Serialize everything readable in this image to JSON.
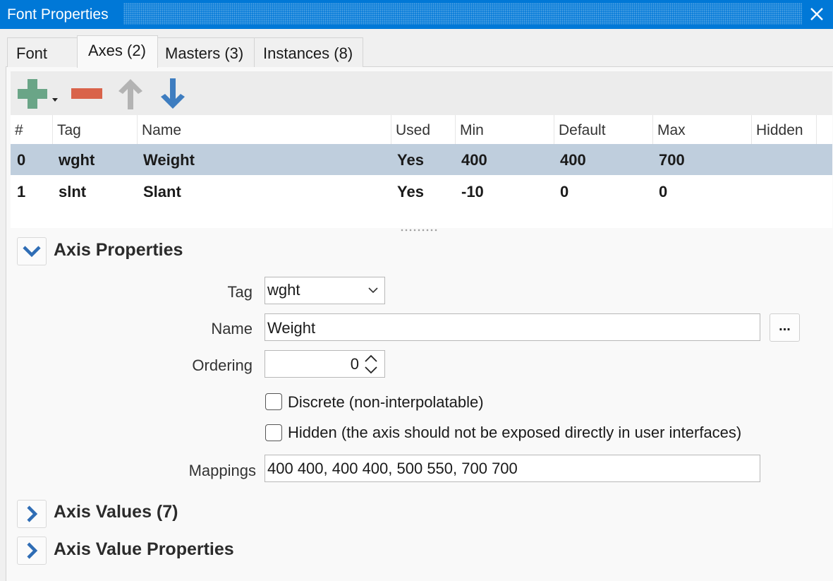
{
  "window": {
    "title": "Font Properties"
  },
  "tabs": [
    {
      "label": "Font"
    },
    {
      "label": "Axes (2)"
    },
    {
      "label": "Masters (3)"
    },
    {
      "label": "Instances (8)"
    }
  ],
  "toolbar": {
    "add_icon": "plus-icon",
    "remove_icon": "minus-icon",
    "up_icon": "arrow-up-icon",
    "down_icon": "arrow-down-icon"
  },
  "grid": {
    "columns": [
      "#",
      "Tag",
      "Name",
      "Used",
      "Min",
      "Default",
      "Max",
      "Hidden"
    ],
    "rows": [
      {
        "index": "0",
        "tag": "wght",
        "name": "Weight",
        "used": "Yes",
        "min": "400",
        "default": "400",
        "max": "700",
        "hidden": ""
      },
      {
        "index": "1",
        "tag": "slnt",
        "name": "Slant",
        "used": "Yes",
        "min": "-10",
        "default": "0",
        "max": "0",
        "hidden": ""
      }
    ],
    "selected_row": 0
  },
  "sections": {
    "axis_properties": "Axis Properties",
    "axis_values": "Axis Values (7)",
    "axis_value_properties": "Axis Value Properties"
  },
  "form": {
    "tag_label": "Tag",
    "tag_value": "wght",
    "name_label": "Name",
    "name_value": "Weight",
    "name_button": "...",
    "ordering_label": "Ordering",
    "ordering_value": "0",
    "discrete_label": "Discrete (non-interpolatable)",
    "discrete_checked": false,
    "hidden_label": "Hidden (the axis should not be exposed directly in user interfaces)",
    "hidden_checked": false,
    "mappings_label": "Mappings",
    "mappings_value": "400 400, 400 400, 500 550, 700 700"
  },
  "colors": {
    "titlebar": "#0078d7",
    "selection": "#bfcedd",
    "add": "#6aa587",
    "remove": "#d9634a",
    "up_disabled": "#b3b3b3",
    "down": "#3e7dc0"
  }
}
